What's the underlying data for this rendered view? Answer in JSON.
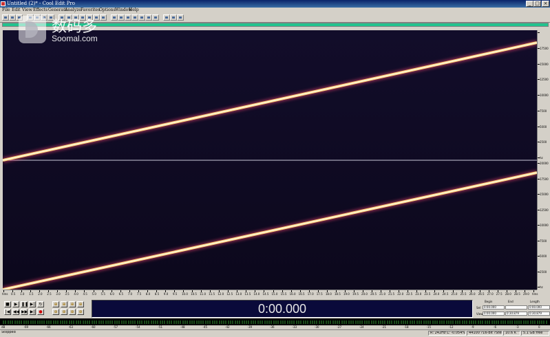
{
  "window": {
    "title": "Untitled (2)* - Cool Edit Pro",
    "minimize": "_",
    "maximize": "□",
    "close": "×"
  },
  "menu": [
    "File",
    "Edit",
    "View",
    "Effects",
    "Generate",
    "Analyze",
    "Favorites",
    "Options",
    "Window",
    "Help"
  ],
  "toolbar": {
    "buttons": [
      "mode-icon",
      "open-icon",
      "save-icon",
      "cut-icon",
      "copy-icon",
      "paste-icon",
      "mix-paste-icon",
      "undo-icon",
      "snap-icon",
      "record-icon",
      "loop-icon",
      "cue-icon",
      "zoom-icon",
      "view-icon",
      "grid-icon",
      "marker-icon",
      "edit-icon",
      "spectral-icon",
      "wave-icon",
      "settings-icon",
      "track-icon",
      "time-icon",
      "help-icon",
      "info-icon"
    ]
  },
  "watermark": {
    "cn": "数码多",
    "en": "Soomal.com"
  },
  "spectral": {
    "channels": 2,
    "colors": {
      "background": "#0e0a22",
      "sweep": "#fff4c8",
      "glow": "#e0406a"
    }
  },
  "freq_ruler": {
    "top": [
      "",
      "17500",
      "15000",
      "12500",
      "10000",
      "7500",
      "5000",
      "2500",
      "hz"
    ],
    "bottom": [
      "20000",
      "17500",
      "15000",
      "12500",
      "10000",
      "7500",
      "5000",
      "2500",
      "hz"
    ]
  },
  "time_ruler": {
    "labels": [
      "hms",
      "0.5",
      "1.0",
      "1.5",
      "2.0",
      "2.5",
      "3.0",
      "3.5",
      "4.0",
      "4.5",
      "5.0",
      "5.5",
      "6.0",
      "6.5",
      "7.0",
      "7.5",
      "8.0",
      "8.5",
      "9.0",
      "9.5",
      "10.0",
      "10.5",
      "11.0",
      "11.5",
      "12.0",
      "12.5",
      "13.0",
      "13.5",
      "14.0",
      "14.5",
      "15.0",
      "15.5",
      "16.0",
      "16.5",
      "17.0",
      "17.5",
      "18.0",
      "18.5",
      "19.0",
      "19.5",
      "20.0",
      "20.5",
      "21.0",
      "21.5",
      "22.0",
      "22.5",
      "23.0",
      "23.5",
      "24.0",
      "24.5",
      "25.0",
      "25.5",
      "26.0",
      "26.5",
      "27.0",
      "27.5",
      "28.0",
      "28.5",
      "29.0",
      "hms"
    ]
  },
  "transport": {
    "row1": [
      "stop",
      "play",
      "pause",
      "play-to-end",
      "loop"
    ],
    "row2": [
      "go-start",
      "rewind",
      "fast-forward",
      "go-end",
      "record"
    ],
    "zoom_row1": [
      "zoom-in-horizontal",
      "zoom-out-horizontal",
      "zoom-full",
      "zoom-in-vertical"
    ],
    "zoom_row2": [
      "zoom-in-left",
      "zoom-in-right",
      "zoom-selection",
      "zoom-out-vertical"
    ]
  },
  "time_display": "0:00.000",
  "selection": {
    "headers": [
      "Begin",
      "End",
      "Length"
    ],
    "rows": [
      {
        "label": "Sel",
        "begin": "0:00.000",
        "end": "",
        "length": "0:00.000"
      },
      {
        "label": "View",
        "begin": "0:00.000",
        "end": "0:30.879",
        "length": "0:30.879"
      }
    ]
  },
  "level_meter": {
    "scale": [
      "dB",
      "-69",
      "-66",
      "-63",
      "-60",
      "-57",
      "-54",
      "-51",
      "-48",
      "-45",
      "-42",
      "-39",
      "-36",
      "-33",
      "-30",
      "-27",
      "-24",
      "-21",
      "-18",
      "-15",
      "-12",
      "-9",
      "-6",
      "-3",
      "0"
    ]
  },
  "status": {
    "state": "Stopped",
    "cells": [
      "R: 242Hz  L: -0.054%",
      "44100 ?16-bit ?Stereo",
      "10.6 K",
      "5.1 GB free"
    ]
  }
}
